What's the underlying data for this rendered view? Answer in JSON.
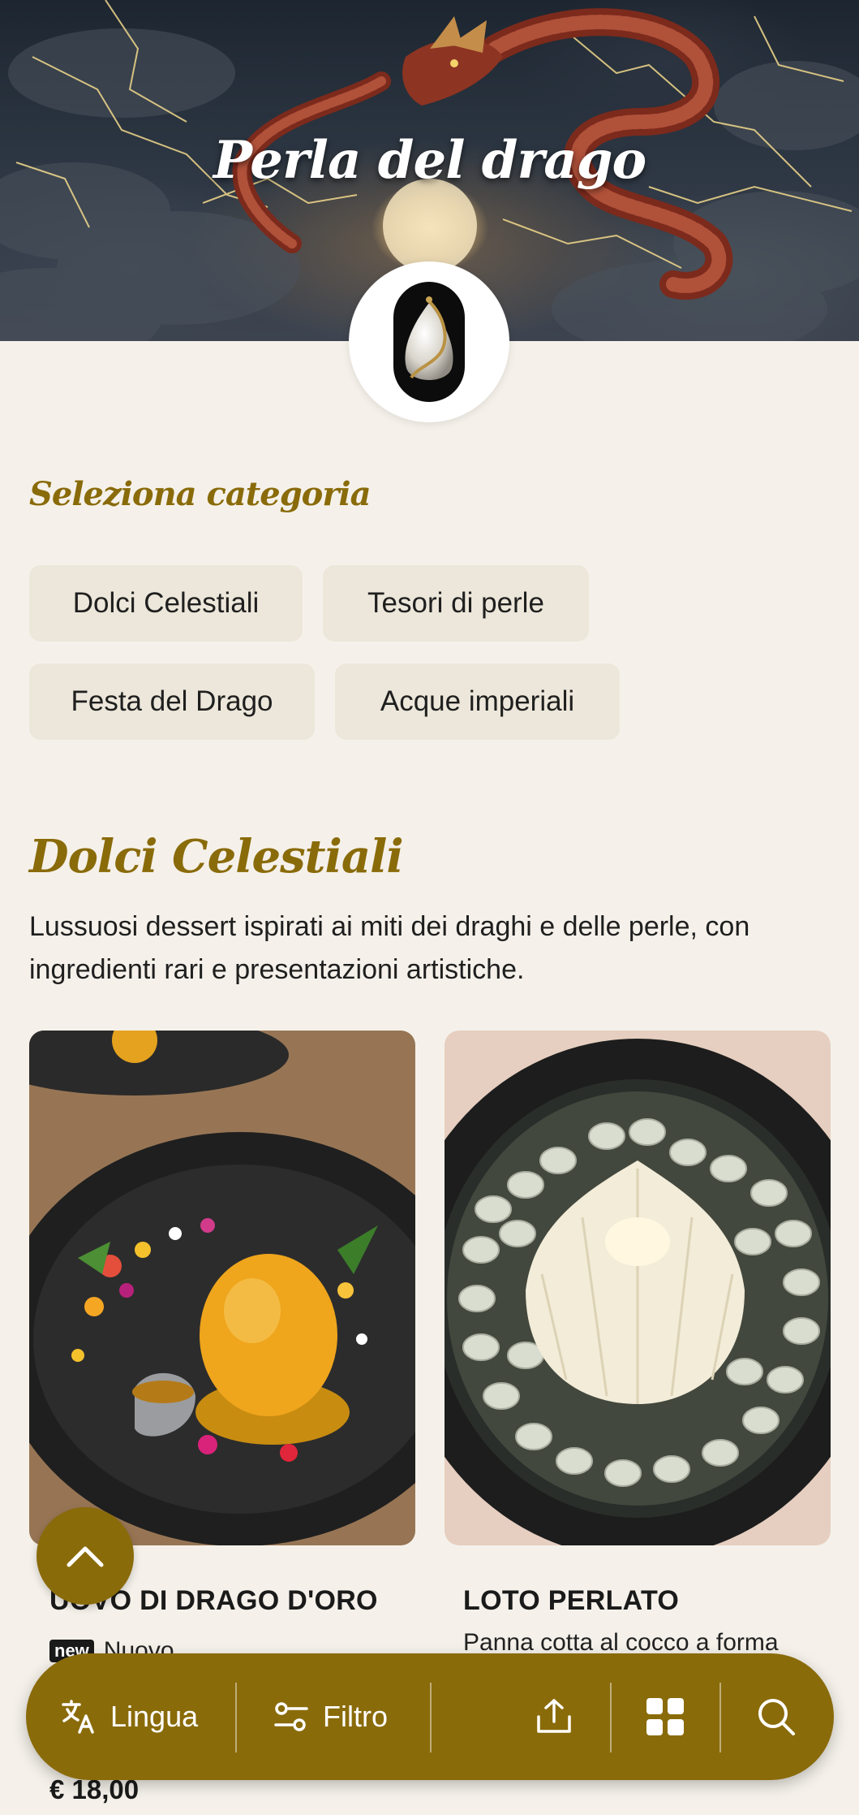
{
  "header": {
    "title": "Perla del drago"
  },
  "category_selector": {
    "label": "Seleziona categoria",
    "chips": [
      "Dolci Celestiali",
      "Tesori di perle",
      "Festa del Drago",
      "Acque imperiali"
    ]
  },
  "category": {
    "title": "Dolci Celestiali",
    "description": "Lussuosi dessert ispirati ai miti dei draghi e delle perle, con ingredienti rari e presentazioni artistiche."
  },
  "items": [
    {
      "name": "UOVO DI DRAGO D'ORO",
      "badge": "new",
      "badge_text": "Nuovo",
      "price": "€ 18,00"
    },
    {
      "name": "LOTO PERLATO",
      "description": "Panna cotta al cocco a forma"
    }
  ],
  "toolbar": {
    "language_label": "Lingua",
    "filter_label": "Filtro",
    "icons": [
      "translate-icon",
      "filter-icon",
      "share-icon",
      "grid-icon",
      "search-icon"
    ]
  },
  "colors": {
    "accent": "#8a6b0a",
    "background": "#f5f1ea",
    "chip_bg": "#ece7da"
  }
}
